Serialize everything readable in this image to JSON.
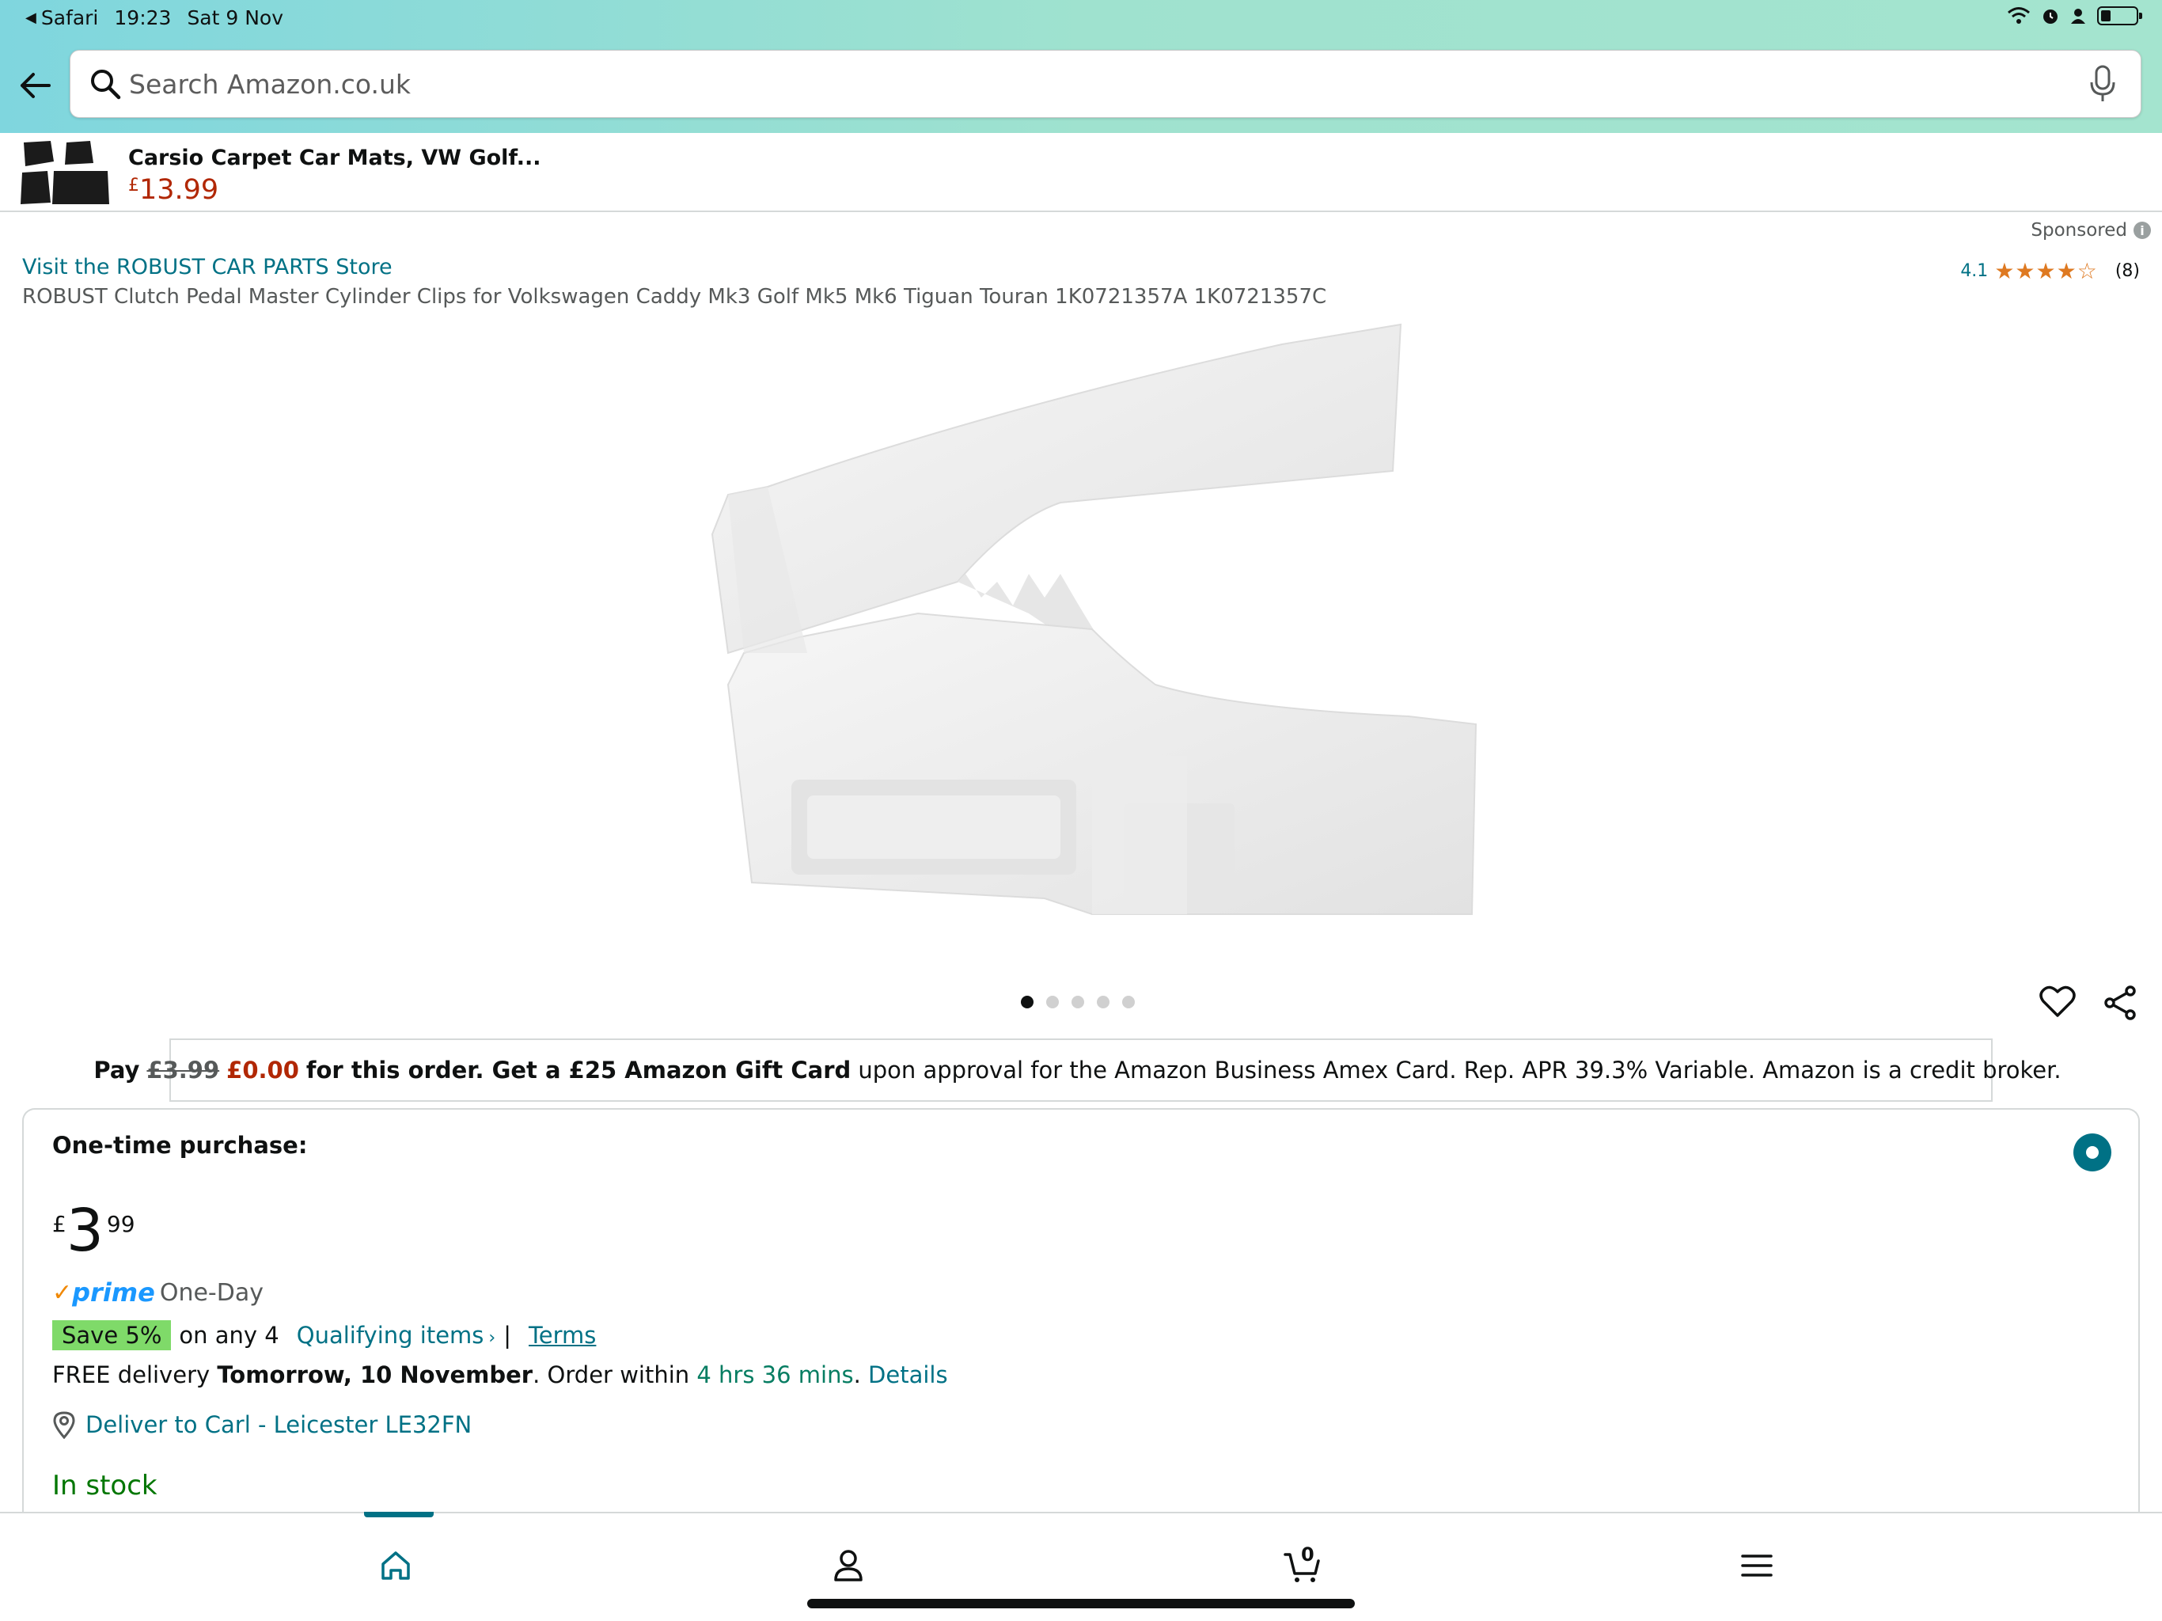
{
  "status_bar": {
    "back_app": "Safari",
    "time": "19:23",
    "date": "Sat 9 Nov"
  },
  "search": {
    "placeholder": "Search Amazon.co.uk",
    "value": ""
  },
  "sticky_product": {
    "title": "Carsio Carpet Car Mats, VW Golf...",
    "currency": "£",
    "price": "13.99"
  },
  "product": {
    "sponsored_label": "Sponsored",
    "store_link": "Visit the ROBUST CAR PARTS Store",
    "rating_value": "4.1",
    "rating_stars": "★★★★☆",
    "rating_count": "(8)",
    "title": "ROBUST Clutch Pedal Master Cylinder Clips for Volkswagen Caddy Mk3 Golf Mk5 Mk6 Tiguan Touran 1K0721357A 1K0721357C",
    "image_count": 5,
    "image_index": 1
  },
  "promo": {
    "pay": "Pay",
    "old_price": "£3.99",
    "new_price": "£0.00",
    "mid_text": "for this order. Get a £25 Amazon Gift Card",
    "tail_text": "upon approval for the Amazon Business Amex Card. Rep. APR 39.3% Variable. Amazon is a credit broker."
  },
  "purchase": {
    "label": "One-time purchase:",
    "currency": "£",
    "price_whole": "3",
    "price_fraction": "99",
    "prime_check": "✓",
    "prime_word": "prime",
    "prime_speed": "One-Day",
    "save_badge": "Save 5%",
    "save_text": "on any 4",
    "qualifying_link": "Qualifying items",
    "separator": "|",
    "terms_link": "Terms",
    "delivery_prefix": "FREE delivery",
    "delivery_date": "Tomorrow, 10 November",
    "delivery_mid": ". Order within",
    "delivery_window": "4 hrs 36 mins",
    "delivery_dot": ".",
    "details_link": "Details",
    "deliver_to": "Deliver to Carl - Leicester LE32FN",
    "stock_status": "In stock"
  },
  "tabs": {
    "cart_count": "0",
    "active": "home"
  },
  "colors": {
    "link": "#007185",
    "price_red": "#b12704",
    "stock_green": "#007600",
    "save_badge": "#7fda69",
    "prime_blue": "#1a98ff",
    "star_orange": "#de7921"
  }
}
